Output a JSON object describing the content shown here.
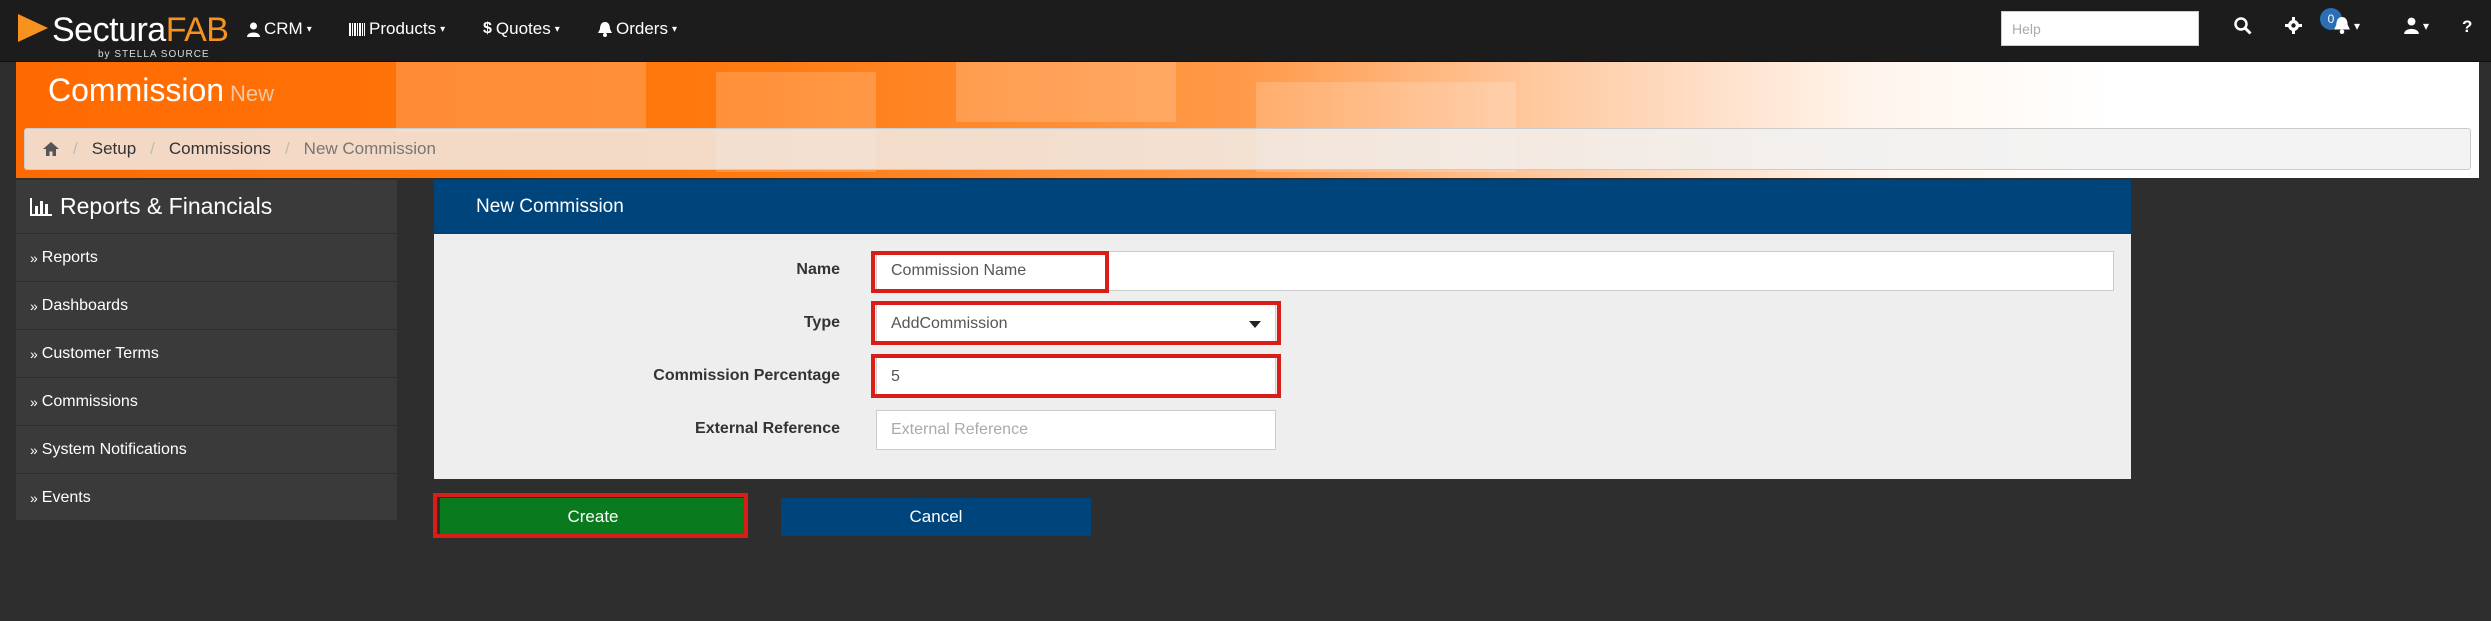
{
  "brand": {
    "name_part1": "Sectura",
    "name_part2": "FAB",
    "tagline": "by STELLA SOURCE",
    "accent_color": "#f7921e"
  },
  "nav": {
    "items": [
      {
        "label": "CRM",
        "icon": "user-icon"
      },
      {
        "label": "Products",
        "icon": "barcode-icon"
      },
      {
        "label": "Quotes",
        "icon": "dollar-icon"
      },
      {
        "label": "Orders",
        "icon": "bell-icon"
      }
    ],
    "help_placeholder": "Help",
    "notification_count": "0",
    "right_icons": [
      "search-icon",
      "gear-icon",
      "bell-icon",
      "user-icon",
      "question-icon"
    ]
  },
  "header": {
    "title": "Commission",
    "subtitle": "New",
    "breadcrumb": [
      "Setup",
      "Commissions",
      "New Commission"
    ]
  },
  "sidebar": {
    "title": "Reports & Financials",
    "items": [
      {
        "label": "Reports"
      },
      {
        "label": "Dashboards"
      },
      {
        "label": "Customer Terms"
      },
      {
        "label": "Commissions"
      },
      {
        "label": "System Notifications"
      },
      {
        "label": "Events"
      }
    ]
  },
  "form": {
    "panel_title": "New Commission",
    "fields": {
      "name": {
        "label": "Name",
        "value": "Commission Name"
      },
      "type": {
        "label": "Type",
        "value": "AddCommission"
      },
      "percentage": {
        "label": "Commission Percentage",
        "value": "5"
      },
      "external_ref": {
        "label": "External Reference",
        "placeholder": "External Reference"
      }
    },
    "create_label": "Create",
    "cancel_label": "Cancel",
    "highlight_color": "#d91e18"
  }
}
